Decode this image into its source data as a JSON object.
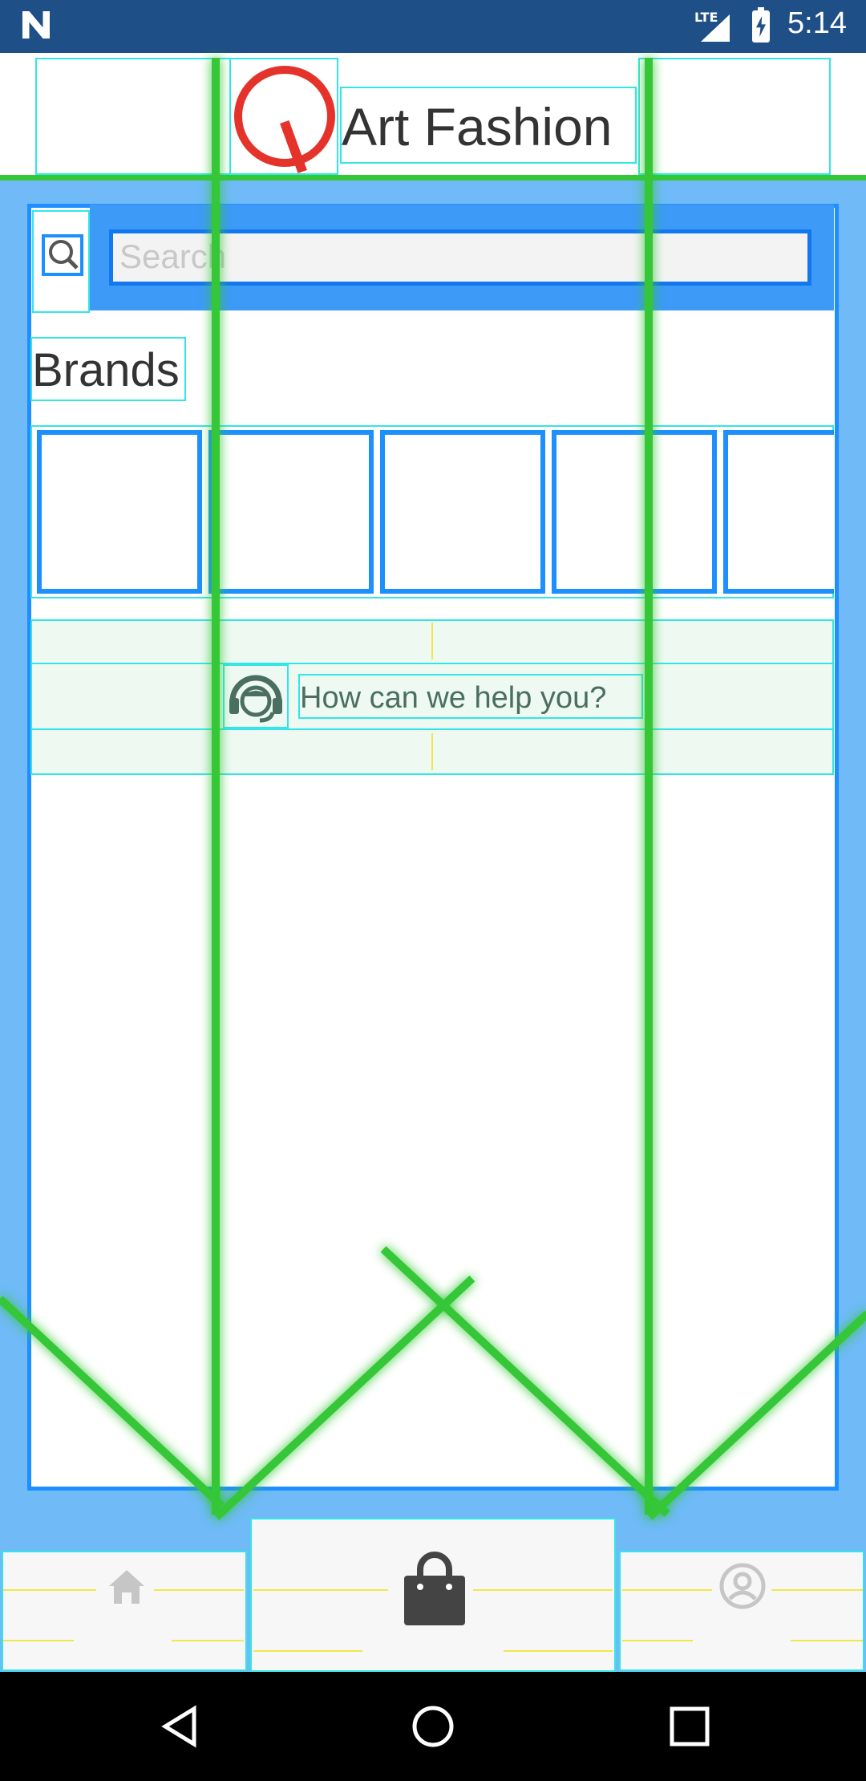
{
  "status_bar": {
    "network": "LTE",
    "time": "5:14"
  },
  "header": {
    "title": "Art Fashion",
    "logo": "logo-icon"
  },
  "search": {
    "placeholder": "Search",
    "icon": "search-icon"
  },
  "brands": {
    "label": "Brands",
    "tiles": [
      "",
      "",
      "",
      "",
      ""
    ]
  },
  "help": {
    "text": "How can we help you?",
    "icon": "headset-icon"
  },
  "bottom_nav": {
    "items": [
      {
        "name": "home",
        "icon": "home-icon"
      },
      {
        "name": "shop",
        "icon": "shopping-bag-icon"
      },
      {
        "name": "profile",
        "icon": "profile-icon"
      }
    ]
  },
  "system_nav": [
    "back-icon",
    "home-circle-icon",
    "recents-icon"
  ],
  "colors": {
    "status_bar": "#1e4f86",
    "accent_blue": "#1e8fff",
    "panel_blue": "#6fbaf7",
    "logo_red": "#e4332a",
    "overlay_green": "#35c737"
  }
}
